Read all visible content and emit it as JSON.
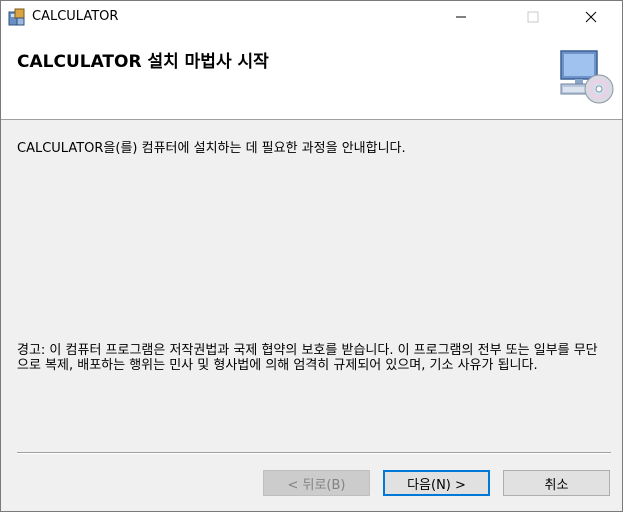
{
  "window": {
    "title": "CALCULATOR"
  },
  "header": {
    "title": "CALCULATOR 설치 마법사 시작"
  },
  "body": {
    "intro": "CALCULATOR을(를) 컴퓨터에 설치하는 데 필요한 과정을 안내합니다.",
    "warning": "경고: 이 컴퓨터 프로그램은 저작권법과 국제 협약의 보호를 받습니다. 이 프로그램의 전부 또는 일부를 무단으로 복제, 배포하는 행위는 민사 및 형사법에 의해 엄격히 규제되어 있으며, 기소 사유가 됩니다."
  },
  "buttons": {
    "back": "< 뒤로(B)",
    "next": "다음(N) >",
    "cancel": "취소"
  },
  "colors": {
    "accent": "#0078d7",
    "background": "#f0f0f0"
  },
  "icons": {
    "app": "installer-icon",
    "header": "computer-disc-icon"
  }
}
